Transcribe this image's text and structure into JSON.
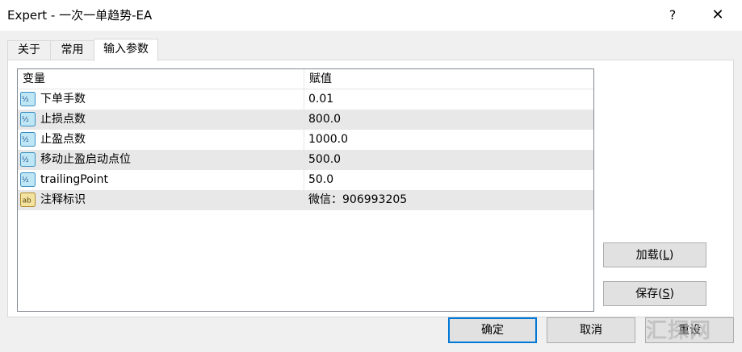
{
  "window": {
    "title": "Expert - 一次一单趋势-EA",
    "help_label": "?",
    "close_label": "✕"
  },
  "tabs": [
    {
      "label": "关于",
      "active": false
    },
    {
      "label": "常用",
      "active": false
    },
    {
      "label": "输入参数",
      "active": true
    }
  ],
  "table": {
    "columns": [
      "变量",
      "赋值"
    ],
    "rows": [
      {
        "icon": "numeric-value-icon",
        "name": "下单手数",
        "value": "0.01"
      },
      {
        "icon": "numeric-value-icon",
        "name": "止损点数",
        "value": "800.0"
      },
      {
        "icon": "numeric-value-icon",
        "name": "止盈点数",
        "value": "1000.0"
      },
      {
        "icon": "numeric-value-icon",
        "name": "移动止盈启动点位",
        "value": "500.0"
      },
      {
        "icon": "numeric-value-icon",
        "name": "trailingPoint",
        "value": "50.0"
      },
      {
        "icon": "string-value-icon",
        "name": "注释标识",
        "value": "微信：906993205"
      }
    ]
  },
  "buttons": {
    "load": {
      "text": "加载(",
      "key": "L",
      "end": ")"
    },
    "save": {
      "text": "保存(",
      "key": "S",
      "end": ")"
    },
    "ok": "确定",
    "cancel": "取消",
    "reset": "重设"
  },
  "watermark": "汇探网",
  "colors": {
    "dialog_bg": "#f0f0f0",
    "alt_row": "#e8e8e8",
    "focus_border": "#0078d7",
    "button_bg": "#e1e1e1"
  }
}
